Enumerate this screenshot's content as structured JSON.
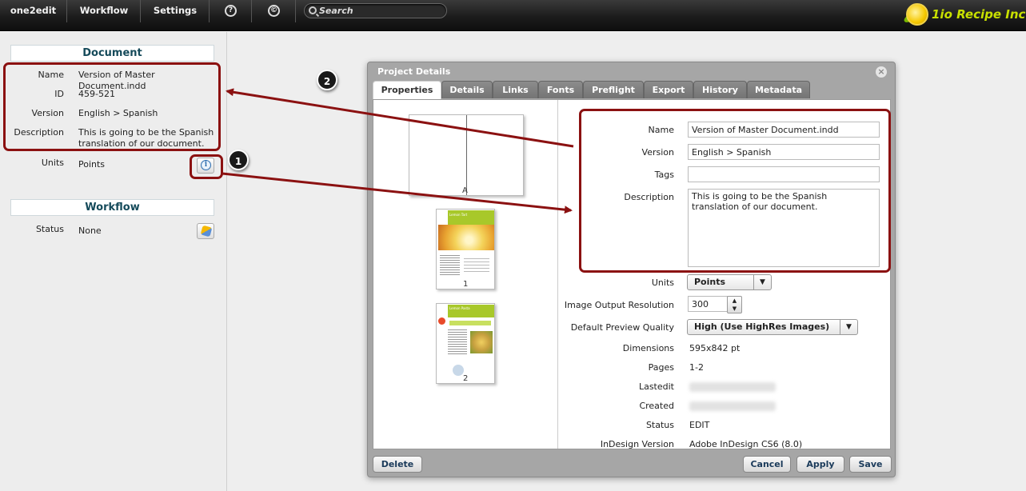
{
  "topbar": {
    "items": [
      {
        "label": "one2edit"
      },
      {
        "label": "Workflow"
      },
      {
        "label": "Settings"
      }
    ],
    "help_icon": "?",
    "copyright_icon": "©",
    "search_placeholder": "Search",
    "brand": "1io Recipe Inc."
  },
  "document_panel": {
    "heading": "Document",
    "fields": [
      {
        "label": "Name",
        "value": "Version of Master Document.indd"
      },
      {
        "label": "ID",
        "value": "459-521"
      },
      {
        "label": "Version",
        "value": "English > Spanish"
      },
      {
        "label": "Description",
        "value": "This is going to be the Spanish translation of our document."
      },
      {
        "label": "Units",
        "value": "Points"
      }
    ]
  },
  "workflow_panel": {
    "heading": "Workflow",
    "status_label": "Status",
    "status_value": "None"
  },
  "callouts": [
    "1",
    "2"
  ],
  "dialog": {
    "title": "Project Details",
    "tabs": [
      "Properties",
      "Details",
      "Links",
      "Fonts",
      "Preflight",
      "Export",
      "History",
      "Metadata"
    ],
    "active_tab": "Properties",
    "thumbnails": [
      {
        "label": "A"
      },
      {
        "label": "1",
        "header": "Lemon Tart"
      },
      {
        "label": "2",
        "header": "Lemon Pasta"
      }
    ],
    "form": {
      "name_label": "Name",
      "name_value": "Version of Master Document.indd",
      "version_label": "Version",
      "version_value": "English > Spanish",
      "tags_label": "Tags",
      "tags_value": "",
      "description_label": "Description",
      "description_value": "This is going to be the Spanish translation of our document.",
      "units_label": "Units",
      "units_value": "Points",
      "resolution_label": "Image Output Resolution",
      "resolution_value": "300",
      "quality_label": "Default Preview Quality",
      "quality_value": "High (Use HighRes Images)",
      "dimensions_label": "Dimensions",
      "dimensions_value": "595x842 pt",
      "pages_label": "Pages",
      "pages_value": "1-2",
      "lastedit_label": "Lastedit",
      "created_label": "Created",
      "status_label": "Status",
      "status_value": "EDIT",
      "indesign_label": "InDesign Version",
      "indesign_value": "Adobe InDesign CS6 (8.0)"
    },
    "buttons": {
      "delete": "Delete",
      "cancel": "Cancel",
      "apply": "Apply",
      "save": "Save"
    }
  },
  "colors": {
    "annotation_red": "#8b1111",
    "heading_teal": "#154a5a",
    "brand_lime": "#c8e000"
  }
}
